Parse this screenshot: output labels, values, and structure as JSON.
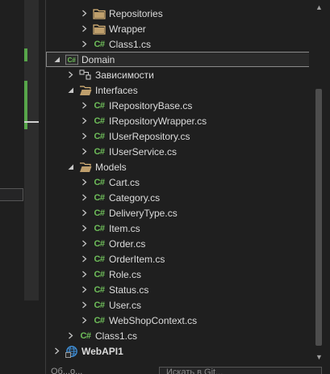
{
  "tree": {
    "items": [
      {
        "label": "Repositories",
        "icon": "folder-icon",
        "expander": "collapsed"
      },
      {
        "label": "Wrapper",
        "icon": "folder-icon",
        "expander": "collapsed"
      },
      {
        "label": "Class1.cs",
        "icon": "csharp-file-icon",
        "expander": "collapsed"
      },
      {
        "label": "Domain",
        "icon": "csharp-project-icon",
        "expander": "expanded"
      },
      {
        "label": "Зависимости",
        "icon": "dependencies-icon",
        "expander": "collapsed"
      },
      {
        "label": "Interfaces",
        "icon": "folder-open-icon",
        "expander": "expanded"
      },
      {
        "label": "IRepositoryBase.cs",
        "icon": "csharp-file-icon",
        "expander": "collapsed"
      },
      {
        "label": "IRepositoryWrapper.cs",
        "icon": "csharp-file-icon",
        "expander": "collapsed"
      },
      {
        "label": "IUserRepository.cs",
        "icon": "csharp-file-icon",
        "expander": "collapsed"
      },
      {
        "label": "IUserService.cs",
        "icon": "csharp-file-icon",
        "expander": "collapsed"
      },
      {
        "label": "Models",
        "icon": "folder-open-icon",
        "expander": "expanded"
      },
      {
        "label": "Cart.cs",
        "icon": "csharp-file-icon",
        "expander": "collapsed"
      },
      {
        "label": "Category.cs",
        "icon": "csharp-file-icon",
        "expander": "collapsed"
      },
      {
        "label": "DeliveryType.cs",
        "icon": "csharp-file-icon",
        "expander": "collapsed"
      },
      {
        "label": "Item.cs",
        "icon": "csharp-file-icon",
        "expander": "collapsed"
      },
      {
        "label": "Order.cs",
        "icon": "csharp-file-icon",
        "expander": "collapsed"
      },
      {
        "label": "OrderItem.cs",
        "icon": "csharp-file-icon",
        "expander": "collapsed"
      },
      {
        "label": "Role.cs",
        "icon": "csharp-file-icon",
        "expander": "collapsed"
      },
      {
        "label": "Status.cs",
        "icon": "csharp-file-icon",
        "expander": "collapsed"
      },
      {
        "label": "User.cs",
        "icon": "csharp-file-icon",
        "expander": "collapsed"
      },
      {
        "label": "WebShopContext.cs",
        "icon": "csharp-file-icon",
        "expander": "collapsed"
      },
      {
        "label": "Class1.cs",
        "icon": "csharp-file-icon",
        "expander": "collapsed"
      },
      {
        "label": "WebAPI1",
        "icon": "web-project-icon",
        "expander": "collapsed"
      }
    ]
  },
  "icons": {
    "csharp_glyph": "C#"
  },
  "colors": {
    "background": "#1f1f1f",
    "folder": "#dcb67a",
    "csharp": "#6fbf5a",
    "web_project": "#3f8fd8",
    "gutter_change": "#57a64a"
  },
  "bottom": {
    "left_text": "Об...о...",
    "search_placeholder": "Искать в Git..."
  }
}
